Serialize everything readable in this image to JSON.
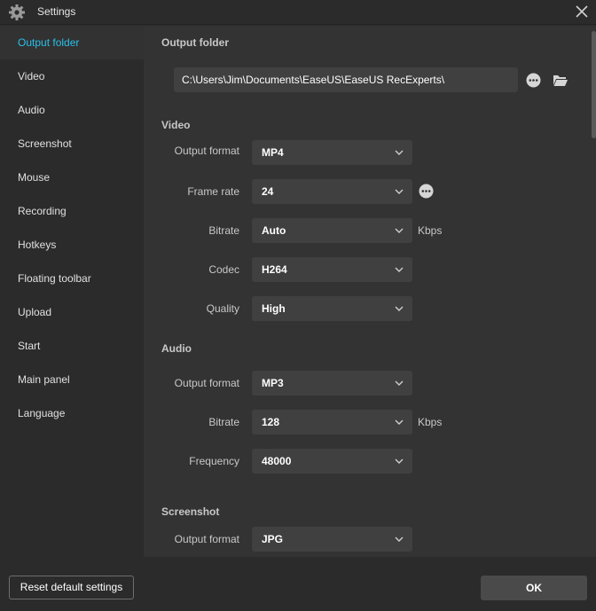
{
  "window": {
    "title": "Settings"
  },
  "sidebar": {
    "items": [
      {
        "label": "Output folder",
        "active": true
      },
      {
        "label": "Video"
      },
      {
        "label": "Audio"
      },
      {
        "label": "Screenshot"
      },
      {
        "label": "Mouse"
      },
      {
        "label": "Recording"
      },
      {
        "label": "Hotkeys"
      },
      {
        "label": "Floating toolbar"
      },
      {
        "label": "Upload"
      },
      {
        "label": "Start"
      },
      {
        "label": "Main panel"
      },
      {
        "label": "Language"
      }
    ]
  },
  "output_folder": {
    "heading": "Output folder",
    "path": "C:\\Users\\Jim\\Documents\\EaseUS\\EaseUS RecExperts\\"
  },
  "video": {
    "heading": "Video",
    "output_format": {
      "label": "Output format",
      "value": "MP4"
    },
    "frame_rate": {
      "label": "Frame rate",
      "value": "24"
    },
    "bitrate": {
      "label": "Bitrate",
      "value": "Auto",
      "unit": "Kbps"
    },
    "codec": {
      "label": "Codec",
      "value": "H264"
    },
    "quality": {
      "label": "Quality",
      "value": "High"
    }
  },
  "audio": {
    "heading": "Audio",
    "output_format": {
      "label": "Output format",
      "value": "MP3"
    },
    "bitrate": {
      "label": "Bitrate",
      "value": "128",
      "unit": "Kbps"
    },
    "frequency": {
      "label": "Frequency",
      "value": "48000"
    }
  },
  "screenshot": {
    "heading": "Screenshot",
    "output_format": {
      "label": "Output format",
      "value": "JPG"
    }
  },
  "footer": {
    "reset_label": "Reset default settings",
    "ok_label": "OK"
  },
  "colors": {
    "accent": "#29c0e8",
    "background": "#2b2b2b",
    "content_background": "#333333",
    "field_background": "#404040"
  }
}
